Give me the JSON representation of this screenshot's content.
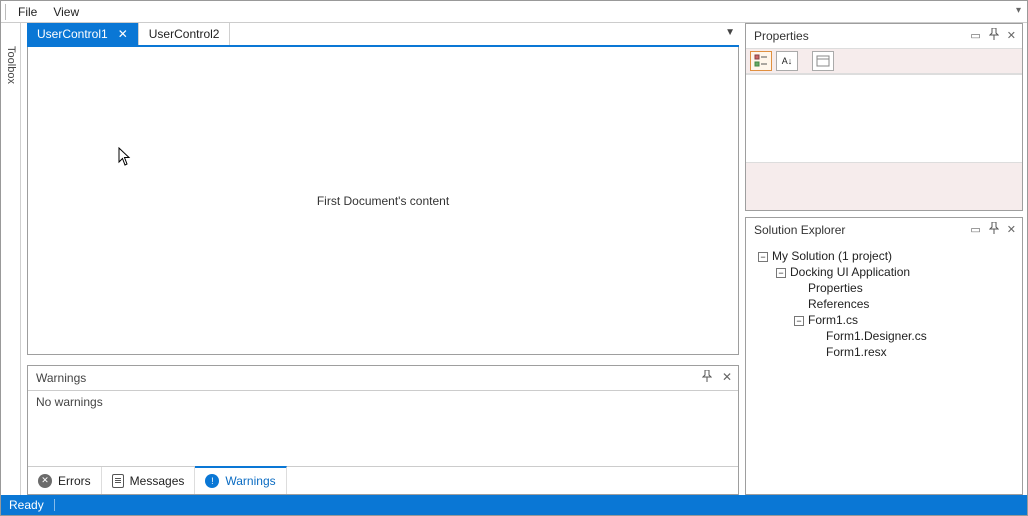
{
  "menu": {
    "file": "File",
    "view": "View"
  },
  "toolbox": {
    "label": "Toolbox"
  },
  "tabs": [
    {
      "label": "UserControl1",
      "active": true
    },
    {
      "label": "UserControl2",
      "active": false
    }
  ],
  "document": {
    "content": "First Document's content"
  },
  "warnings_panel": {
    "title": "Warnings",
    "body": "No warnings",
    "tabs": {
      "errors": "Errors",
      "messages": "Messages",
      "warnings": "Warnings"
    }
  },
  "properties": {
    "title": "Properties",
    "buttons": {
      "categorized": "≣",
      "az": "A↓Z",
      "pages": "▭"
    }
  },
  "solution_explorer": {
    "title": "Solution Explorer",
    "tree": {
      "root": "My Solution (1 project)",
      "project": "Docking UI Application",
      "properties": "Properties",
      "references": "References",
      "form": "Form1.cs",
      "designer": "Form1.Designer.cs",
      "resx": "Form1.resx"
    }
  },
  "status": {
    "text": "Ready"
  }
}
